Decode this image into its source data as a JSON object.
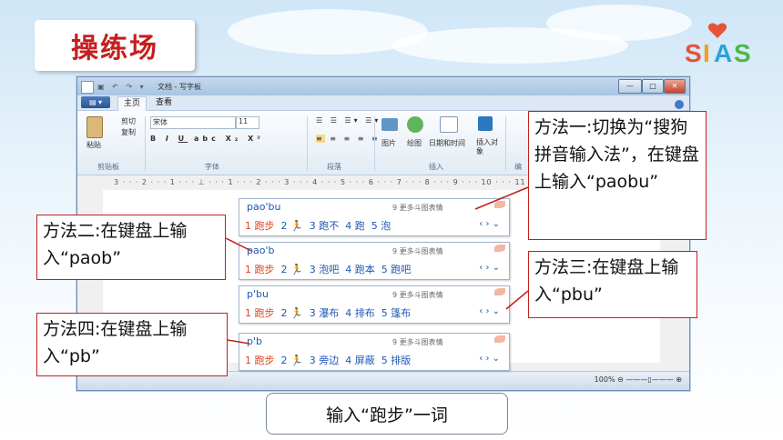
{
  "slide_title": "操练场",
  "logo_text": "SIAS",
  "window": {
    "title": "文档 - 写字板",
    "tabs": [
      "主页",
      "查看"
    ],
    "clipboard": {
      "paste": "粘贴",
      "cut": "剪切",
      "copy": "复制",
      "group": "剪贴板"
    },
    "font": {
      "name": "宋体",
      "size": "11",
      "group": "字体"
    },
    "paragraph_group": "段落",
    "insert": {
      "picture": "图片",
      "paint": "绘图",
      "datetime": "日期和时间",
      "object": "插入对象",
      "group": "插入"
    },
    "edit_group": "编",
    "ruler": "3 · · · 2 · · · 1 · · · ⊥ · · · 1 · · · 2 · · · 3 · · · 4 · · · 5 · · · 6 · · · 7 · · · 8 · · · 9 · · · 10 · · · 11 · · · 12 · · ·",
    "zoom": "100%"
  },
  "ime_panels": [
    {
      "input": "pao'bu",
      "hint": "9 更多斗图表情",
      "candidates": [
        "1 跑步",
        "2 🏃",
        "3 跑不",
        "4 跑",
        "5 泡"
      ]
    },
    {
      "input": "pao'b",
      "hint": "9 更多斗图表情",
      "candidates": [
        "1 跑步",
        "2 🏃",
        "3 泡吧",
        "4 跑本",
        "5 跑吧"
      ]
    },
    {
      "input": "p'bu",
      "hint": "9 更多斗图表情",
      "candidates": [
        "1 跑步",
        "2 🏃",
        "3 瀑布",
        "4 排布",
        "5 篷布"
      ]
    },
    {
      "input": "p'b",
      "hint": "9 更多斗图表情",
      "candidates": [
        "1 跑步",
        "2 🏃",
        "3 旁边",
        "4 屏蔽",
        "5 排版"
      ]
    }
  ],
  "callouts": {
    "method1": "方法一:切换为“搜狗拼音输入法”，在键盘上输入“paobu”",
    "method2": "方法二:在键盘上输入“paob”",
    "method3": "方法三:在键盘上输入“pbu”",
    "method4": "方法四:在键盘上输入“pb”"
  },
  "caption": "输入“跑步”一词",
  "colors": {
    "title_red": "#c3201f",
    "candidate_blue": "#1f58b5",
    "first_candidate": "#e0421c"
  }
}
